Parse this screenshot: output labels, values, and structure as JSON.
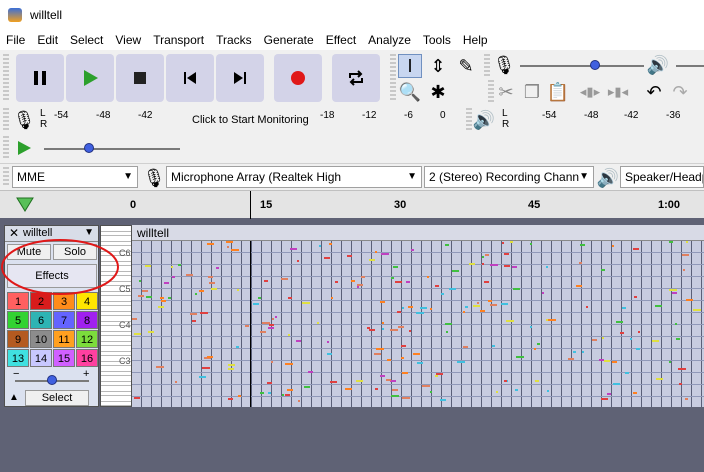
{
  "window": {
    "title": "willtell"
  },
  "menu": [
    "File",
    "Edit",
    "Select",
    "View",
    "Transport",
    "Tracks",
    "Generate",
    "Effect",
    "Analyze",
    "Tools",
    "Help"
  ],
  "recording_meter": {
    "ticks": [
      "-54",
      "-48",
      "-42",
      "Click to Start Monitoring",
      "-18",
      "-12",
      "-6",
      "0"
    ]
  },
  "playback_meter": {
    "ticks": [
      "-54",
      "-48",
      "-42",
      "-36"
    ]
  },
  "meter_channels": [
    "L",
    "R"
  ],
  "devices": {
    "host": "MME",
    "recording_device": "Microphone Array (Realtek High",
    "channels": "2 (Stereo) Recording Chann",
    "playback_device": "Speaker/Headp"
  },
  "timeline": {
    "labels": [
      "0",
      "15",
      "30",
      "45",
      "1:00"
    ]
  },
  "track": {
    "name": "willtell",
    "clip_name": "willtell",
    "mute_label": "Mute",
    "solo_label": "Solo",
    "effects_label": "Effects",
    "select_label": "Select",
    "channel_buttons": [
      {
        "label": "1",
        "color": "#ff6060"
      },
      {
        "label": "2",
        "color": "#d81c1c"
      },
      {
        "label": "3",
        "color": "#ff8c1a"
      },
      {
        "label": "4",
        "color": "#ffe600"
      },
      {
        "label": "5",
        "color": "#32d232"
      },
      {
        "label": "6",
        "color": "#2eb4b4"
      },
      {
        "label": "7",
        "color": "#6464ff"
      },
      {
        "label": "8",
        "color": "#a020f0"
      },
      {
        "label": "9",
        "color": "#b45a20"
      },
      {
        "label": "10",
        "color": "#8c8c8c"
      },
      {
        "label": "11",
        "color": "#ffa020"
      },
      {
        "label": "12",
        "color": "#7cdc3c"
      },
      {
        "label": "13",
        "color": "#40e0e0"
      },
      {
        "label": "14",
        "color": "#c8c8ff"
      },
      {
        "label": "15",
        "color": "#d060ff"
      },
      {
        "label": "16",
        "color": "#ff40a0"
      }
    ],
    "octave_labels": [
      "C6",
      "C5",
      "C4",
      "C3"
    ]
  },
  "colors": {
    "annotation_circle": "#e01818",
    "note_default": "#e08060",
    "selection_bg": "#c8cce0"
  }
}
